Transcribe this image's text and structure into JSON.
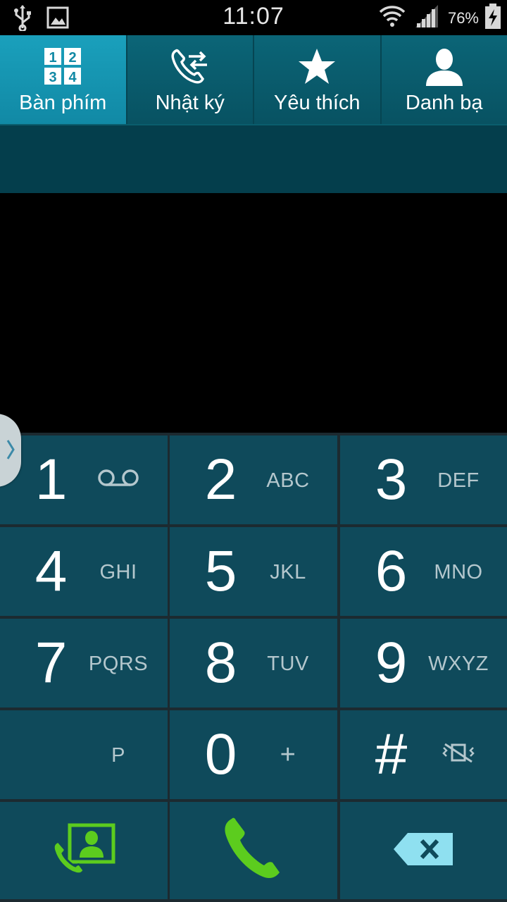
{
  "status_bar": {
    "time": "11:07",
    "battery_percent": "76%",
    "icons": [
      "usb-icon",
      "picture-notification-icon",
      "wifi-icon",
      "signal-icon",
      "battery-charging-icon"
    ]
  },
  "tabs": [
    {
      "label": "Bàn phím",
      "icon": "keypad-grid-icon",
      "active": true
    },
    {
      "label": "Nhật ký",
      "icon": "call-log-icon",
      "active": false
    },
    {
      "label": "Yêu thích",
      "icon": "star-icon",
      "active": false
    },
    {
      "label": "Danh bạ",
      "icon": "contact-person-icon",
      "active": false
    }
  ],
  "tab_icon_digits": [
    "1",
    "2",
    "3",
    "4"
  ],
  "dialer": {
    "number": ""
  },
  "keys": [
    {
      "digit": "1",
      "letters": "",
      "icon": "voicemail-icon"
    },
    {
      "digit": "2",
      "letters": "ABC"
    },
    {
      "digit": "3",
      "letters": "DEF"
    },
    {
      "digit": "4",
      "letters": "GHI"
    },
    {
      "digit": "5",
      "letters": "JKL"
    },
    {
      "digit": "6",
      "letters": "MNO"
    },
    {
      "digit": "7",
      "letters": "PQRS"
    },
    {
      "digit": "8",
      "letters": "TUV"
    },
    {
      "digit": "9",
      "letters": "WXYZ"
    },
    {
      "digit": "*",
      "letters": "P"
    },
    {
      "digit": "0",
      "letters": "+"
    },
    {
      "digit": "#",
      "letters": "",
      "icon": "mute-vibrate-icon"
    }
  ],
  "actions": {
    "left": "add-contact-icon",
    "center": "call-icon",
    "right": "backspace-icon"
  },
  "colors": {
    "tab_active": "#1aa0bc",
    "tab_inactive": "#0b6577",
    "key_background": "#0f4a5b",
    "call_green": "#5ccc1e"
  }
}
